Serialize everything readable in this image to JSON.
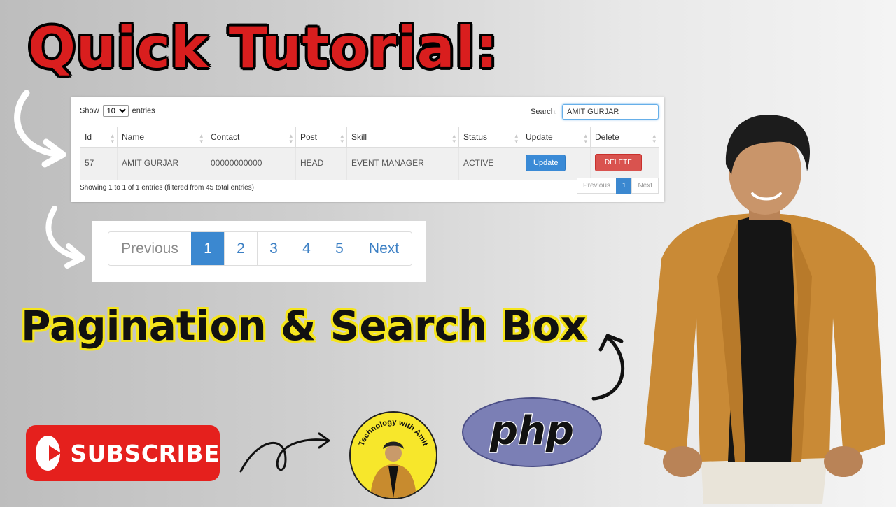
{
  "headline": "Quick Tutorial:",
  "datatable": {
    "show_label": "Show",
    "entries_value": "10",
    "entries_label": "entries",
    "search_label": "Search:",
    "search_value": "AMIT GURJAR",
    "columns": [
      "Id",
      "Name",
      "Contact",
      "Post",
      "Skill",
      "Status",
      "Update",
      "Delete"
    ],
    "rows": [
      {
        "id": "57",
        "name": "AMIT GURJAR",
        "contact": "00000000000",
        "post": "HEAD",
        "skill": "EVENT MANAGER",
        "status": "ACTIVE",
        "update_label": "Update",
        "delete_label": "DELETE"
      }
    ],
    "info": "Showing 1 to 1 of 1 entries (filtered from 45 total entries)",
    "pager": {
      "previous": "Previous",
      "current": "1",
      "next": "Next"
    }
  },
  "big_pagination": {
    "previous": "Previous",
    "pages": [
      "1",
      "2",
      "3",
      "4",
      "5"
    ],
    "active_page": "1",
    "next": "Next"
  },
  "subtitle": "Pagination & Search Box",
  "subscribe_label": "SUBSCRIBE",
  "channel_name": "Technology with Amit",
  "php_logo_text": "php",
  "colors": {
    "headline": "#d91e1e",
    "subtitle_outline": "#f5e51c",
    "pager_active": "#3b88d0",
    "update_button": "#3a8ad6",
    "delete_button": "#d9534f",
    "subscribe": "#e5201d",
    "php_logo": "#7b7fb5"
  },
  "icons": [
    "curved-arrow-icon",
    "play-icon",
    "sort-icon"
  ]
}
